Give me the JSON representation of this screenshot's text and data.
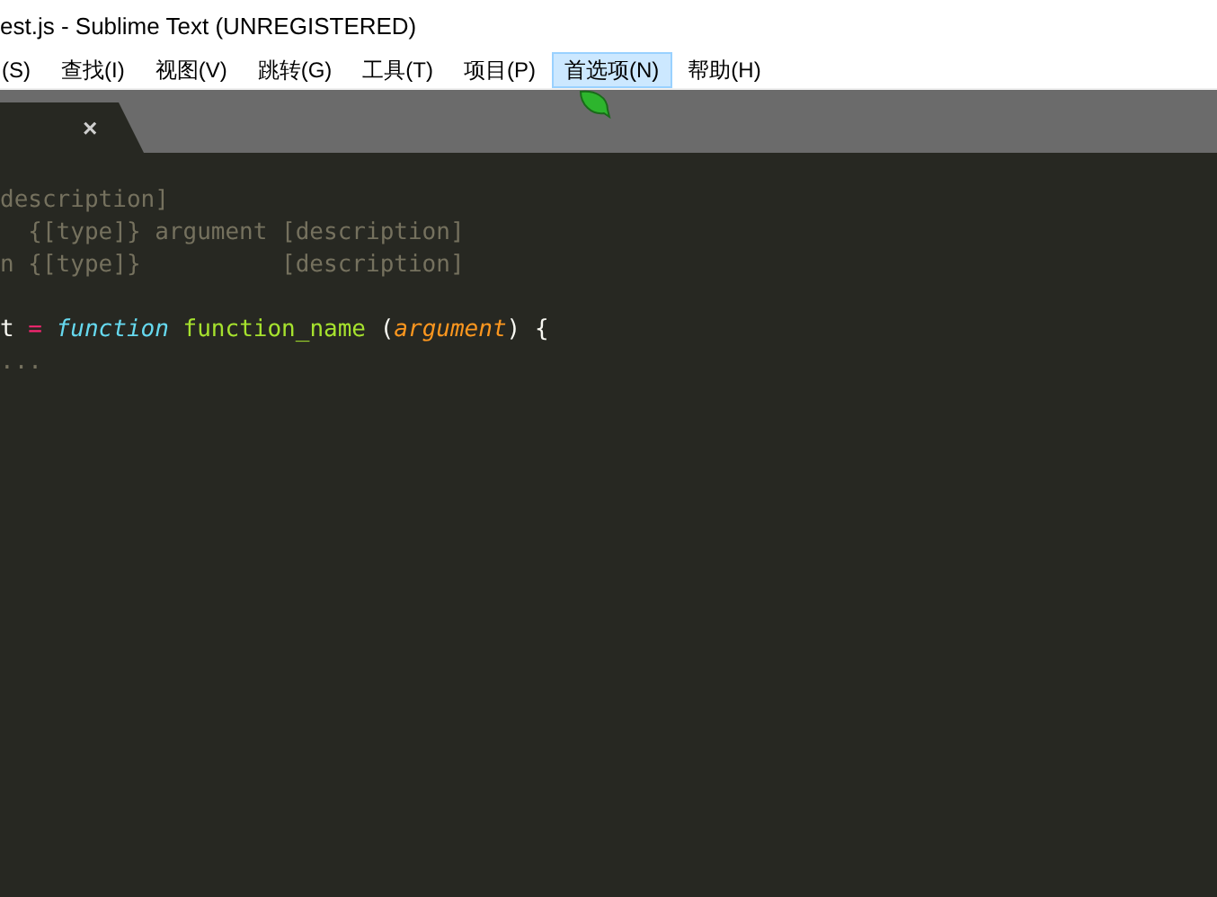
{
  "window": {
    "title": "est.js - Sublime Text (UNREGISTERED)"
  },
  "menu": [
    {
      "label": "(S)",
      "selected": false
    },
    {
      "label": "查找(I)",
      "selected": false
    },
    {
      "label": "视图(V)",
      "selected": false
    },
    {
      "label": "跳转(G)",
      "selected": false
    },
    {
      "label": "工具(T)",
      "selected": false
    },
    {
      "label": "项目(P)",
      "selected": false
    },
    {
      "label": "首选项(N)",
      "selected": true
    },
    {
      "label": "帮助(H)",
      "selected": false
    }
  ],
  "tab": {
    "close": "×"
  },
  "code": [
    [
      {
        "text": "description]",
        "kind": "comment"
      }
    ],
    [
      {
        "text": "  {[type]} argument [description]",
        "kind": "comment"
      }
    ],
    [
      {
        "text": "n {[type]}          [description]",
        "kind": "comment"
      }
    ],
    [
      {
        "text": "t ",
        "kind": "plain",
        "blank_before": true
      },
      {
        "text": "=",
        "kind": "operator"
      },
      {
        "text": " function",
        "kind": "storage"
      },
      {
        "text": " function_name",
        "kind": "entity"
      },
      {
        "text": " (",
        "kind": "plain"
      },
      {
        "text": "argument",
        "kind": "param"
      },
      {
        "text": ") {",
        "kind": "plain"
      }
    ],
    [
      {
        "text": "...",
        "kind": "comment"
      }
    ]
  ]
}
